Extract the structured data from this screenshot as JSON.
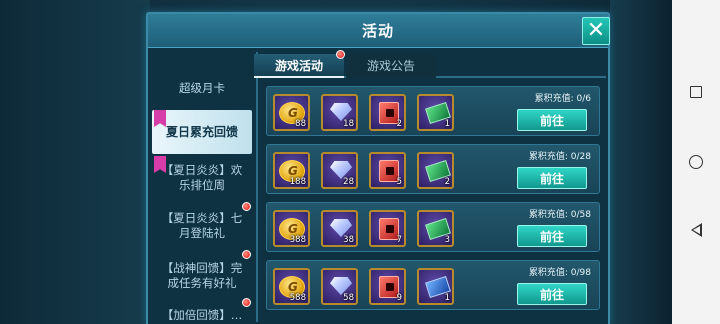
{
  "window": {
    "title": "活动",
    "close_icon": "close-icon"
  },
  "sidebar": {
    "items": [
      {
        "label": "超级月卡",
        "active": false,
        "ribbon": false,
        "badge": false
      },
      {
        "label": "夏日累充回馈",
        "active": true,
        "ribbon": true,
        "badge": false
      },
      {
        "label": "【夏日炎炎】欢乐排位周",
        "active": false,
        "ribbon": true,
        "badge": false
      },
      {
        "label": "【夏日炎炎】七月登陆礼",
        "active": false,
        "ribbon": false,
        "badge": true
      },
      {
        "label": "【战神回馈】完成任务有好礼",
        "active": false,
        "ribbon": false,
        "badge": true
      },
      {
        "label": "【加倍回馈】…",
        "active": false,
        "ribbon": false,
        "badge": true
      }
    ]
  },
  "tabs": [
    {
      "label": "游戏活动",
      "active": true,
      "badge": true
    },
    {
      "label": "游戏公告",
      "active": false,
      "badge": false
    }
  ],
  "rewards": [
    {
      "requirement": "累积充值: 0/6",
      "button": "前往",
      "items": [
        {
          "icon": "gold-coin-icon",
          "qty": "88"
        },
        {
          "icon": "diamond-icon",
          "qty": "18"
        },
        {
          "icon": "red-cube-icon",
          "qty": "2"
        },
        {
          "icon": "green-card-icon",
          "qty": "1"
        }
      ]
    },
    {
      "requirement": "累积充值: 0/28",
      "button": "前往",
      "items": [
        {
          "icon": "gold-coin-icon",
          "qty": "188"
        },
        {
          "icon": "diamond-icon",
          "qty": "28"
        },
        {
          "icon": "red-cube-icon",
          "qty": "5"
        },
        {
          "icon": "green-card-icon",
          "qty": "2"
        }
      ]
    },
    {
      "requirement": "累积充值: 0/58",
      "button": "前往",
      "items": [
        {
          "icon": "gold-coin-icon",
          "qty": "388"
        },
        {
          "icon": "diamond-icon",
          "qty": "38"
        },
        {
          "icon": "red-cube-icon",
          "qty": "7"
        },
        {
          "icon": "green-card-icon",
          "qty": "3"
        }
      ]
    },
    {
      "requirement": "累积充值: 0/98",
      "button": "前往",
      "items": [
        {
          "icon": "gold-coin-icon",
          "qty": "588"
        },
        {
          "icon": "diamond-icon",
          "qty": "58"
        },
        {
          "icon": "red-cube-icon",
          "qty": "9"
        },
        {
          "icon": "blue-card-icon",
          "qty": "1"
        }
      ]
    }
  ],
  "system_nav": {
    "recents_icon": "square-icon",
    "home_icon": "circle-icon",
    "back_icon": "triangle-back-icon"
  },
  "colors": {
    "accent": "#1fb8aa",
    "badge": "#e01818",
    "ribbon": "#d63da8",
    "panel_border": "#3b8aa6"
  }
}
